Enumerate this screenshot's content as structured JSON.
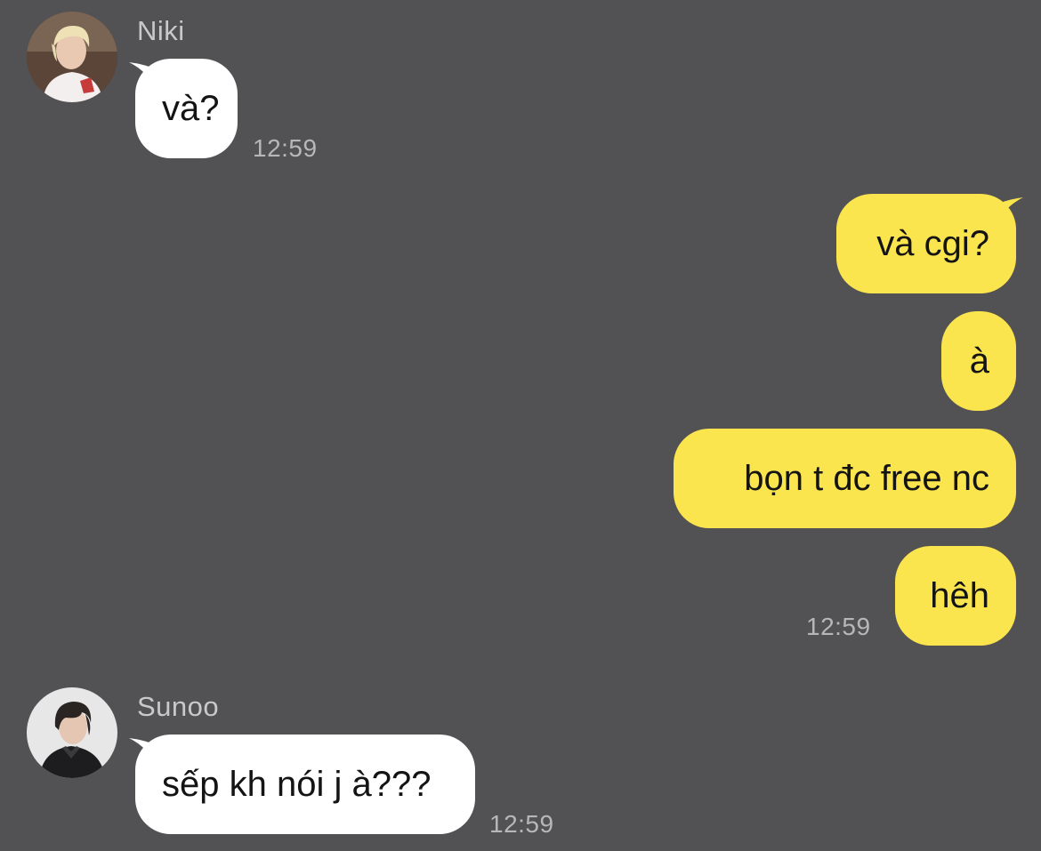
{
  "colors": {
    "background": "#525153",
    "incoming_bubble": "#ffffff",
    "outgoing_bubble": "#fbe54e",
    "sender_name": "#c9c8cb",
    "timestamp": "#b7b6b9"
  },
  "messages": [
    {
      "direction": "incoming",
      "sender": "Niki",
      "avatar": "avatar-photo-blonde",
      "bubbles": [
        {
          "text": "và?"
        }
      ],
      "time": "12:59"
    },
    {
      "direction": "outgoing",
      "bubbles": [
        {
          "text": "và cgi?"
        },
        {
          "text": "à"
        },
        {
          "text": "bọn t đc free nc"
        },
        {
          "text": "hêh"
        }
      ],
      "time": "12:59"
    },
    {
      "direction": "incoming",
      "sender": "Sunoo",
      "avatar": "avatar-photo-dark-hair",
      "bubbles": [
        {
          "text": "sếp kh nói j à???"
        }
      ],
      "time": "12:59"
    }
  ]
}
